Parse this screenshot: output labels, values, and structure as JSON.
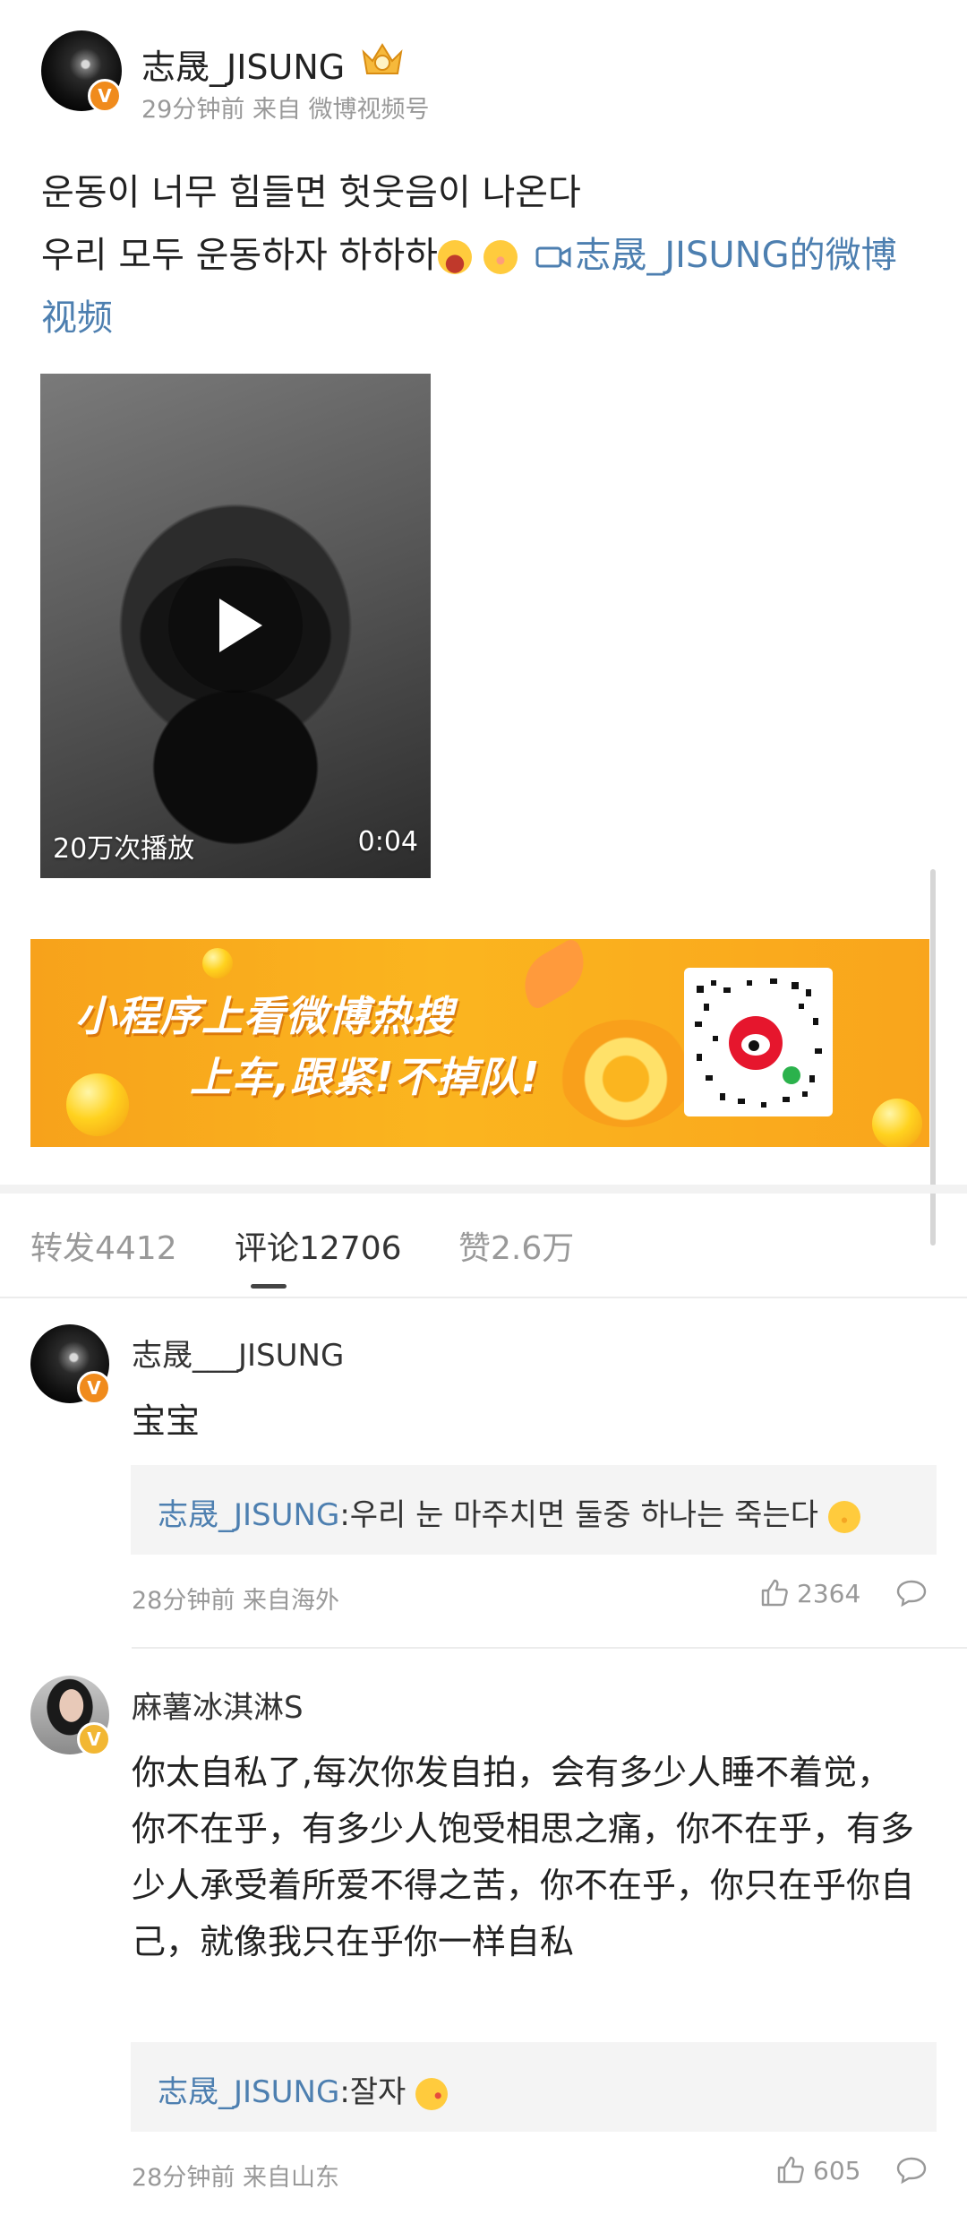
{
  "post": {
    "username": "志晟_JISUNG",
    "meta": "29分钟前 来自 微博视频号",
    "line1": "운동이 너무 힘들면 헛웃음이 나온다",
    "line2": "우리 모두 운동하자 하하하",
    "link_text": "志晟_JISUNG的微博",
    "link_text2": "视频",
    "video": {
      "play_count": "20万次播放",
      "duration": "0:04"
    }
  },
  "banner": {
    "line1": "小程序上看微博热搜",
    "line2": "上车,跟紧!不掉队!"
  },
  "tabs": [
    {
      "label": "转发4412",
      "active": false
    },
    {
      "label": "评论12706",
      "active": true
    },
    {
      "label": "赞2.6万",
      "active": false
    }
  ],
  "comments": [
    {
      "name": "志晟___JISUNG",
      "text": "宝宝",
      "quote_author": "志晟_JISUNG",
      "quote_text": ":우리 눈 마주치면 둘중 하나는 죽는다",
      "meta": "28分钟前 来自海外",
      "likes": "2364"
    },
    {
      "name": "麻薯冰淇淋S",
      "text": "你太自私了,每次你发自拍，会有多少人睡不着觉，你不在乎，有多少人饱受相思之痛，你不在乎，有多少人承受着所爱不得之苦，你不在乎，你只在乎你自己，就像我只在乎你一样自私",
      "quote_author": "志晟_JISUNG",
      "quote_text": ":잘자",
      "meta": "28分钟前 来自山东",
      "likes": "605"
    }
  ],
  "colors": {
    "link": "#4d7fb0",
    "badge_orange": "#f08b1c",
    "badge_gold": "#f2b733",
    "banner": "#fbb51f"
  }
}
